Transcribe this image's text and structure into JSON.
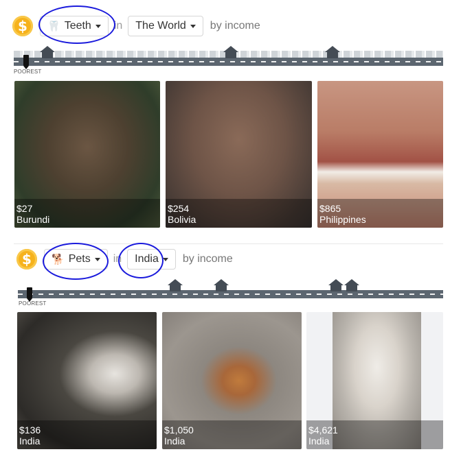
{
  "section1": {
    "coin_icon": "dollar-coin-icon",
    "topic": {
      "icon": "tooth-icon",
      "label": "Teeth"
    },
    "in_label": "in",
    "place": {
      "label": "The World"
    },
    "by_income": "by income",
    "poorest_label": "POOREST",
    "cards": [
      {
        "price": "$27",
        "country": "Burundi",
        "color": "#5b4a3b"
      },
      {
        "price": "$254",
        "country": "Bolivia",
        "color": "#6e5447"
      },
      {
        "price": "$865",
        "country": "Philippines",
        "color": "#b98068"
      }
    ]
  },
  "section2": {
    "coin_icon": "dollar-coin-icon",
    "topic": {
      "icon": "dog-icon",
      "label": "Pets"
    },
    "in_label": "in",
    "place": {
      "label": "India"
    },
    "by_income": "by income",
    "poorest_label": "POOREST",
    "cards": [
      {
        "price": "$136",
        "country": "India",
        "color": "#4a4741"
      },
      {
        "price": "$1,050",
        "country": "India",
        "color": "#8d8780"
      },
      {
        "price": "$4,621",
        "country": "India",
        "color": "#b9b4ad"
      }
    ]
  },
  "colors": {
    "coin": "#f6b21c",
    "strip": "#5c6670",
    "house": "#444c55",
    "scribble": "#1a1adc"
  }
}
